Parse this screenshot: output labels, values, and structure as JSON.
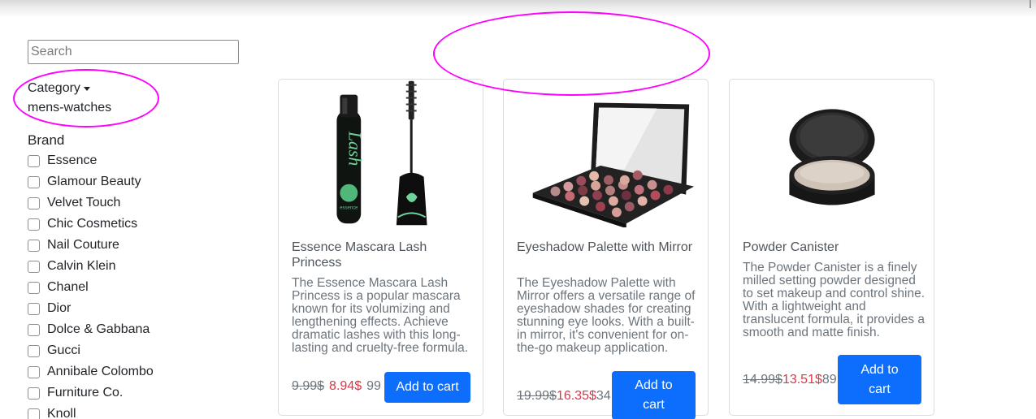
{
  "search": {
    "placeholder": "Search",
    "value": ""
  },
  "filters": {
    "category_label": "Category",
    "category_value": "mens-watches",
    "brand_heading": "Brand",
    "brands": [
      "Essence",
      "Glamour Beauty",
      "Velvet Touch",
      "Chic Cosmetics",
      "Nail Couture",
      "Calvin Klein",
      "Chanel",
      "Dior",
      "Dolce & Gabbana",
      "Gucci",
      "Annibale Colombo",
      "Furniture Co.",
      "Knoll"
    ]
  },
  "products": [
    {
      "title": "Essence Mascara Lash Princess",
      "description": "The Essence Mascara Lash Princess is a popular mascara known for its volumizing and lengthening effects. Achieve dramatic lashes with this long-lasting and cruelty-free formula.",
      "price_old": "9.99$",
      "price_new": "8.94$",
      "stock": "99",
      "button": "Add to cart",
      "image": "mascara-image"
    },
    {
      "title": "Eyeshadow Palette with Mirror",
      "description": "The Eyeshadow Palette with Mirror offers a versatile range of eyeshadow shades for creating stunning eye looks. With a built-in mirror, it's convenient for on-the-go makeup application.",
      "price_old": "19.99$",
      "price_new": "16.35$",
      "stock": "34",
      "button": "Add to cart",
      "image": "eyeshadow-palette-image"
    },
    {
      "title": "Powder Canister",
      "description": "The Powder Canister is a finely milled setting powder designed to set makeup and control shine. With a lightweight and translucent formula, it provides a smooth and matte finish.",
      "price_old": "14.99$",
      "price_new": "13.51$",
      "stock": "89",
      "button": "Add to cart",
      "image": "powder-compact-image"
    }
  ],
  "colors": {
    "accent": "#0d6efd",
    "sale": "#dc3545",
    "annotation": "#ff00ff",
    "muted": "#6c757d"
  }
}
